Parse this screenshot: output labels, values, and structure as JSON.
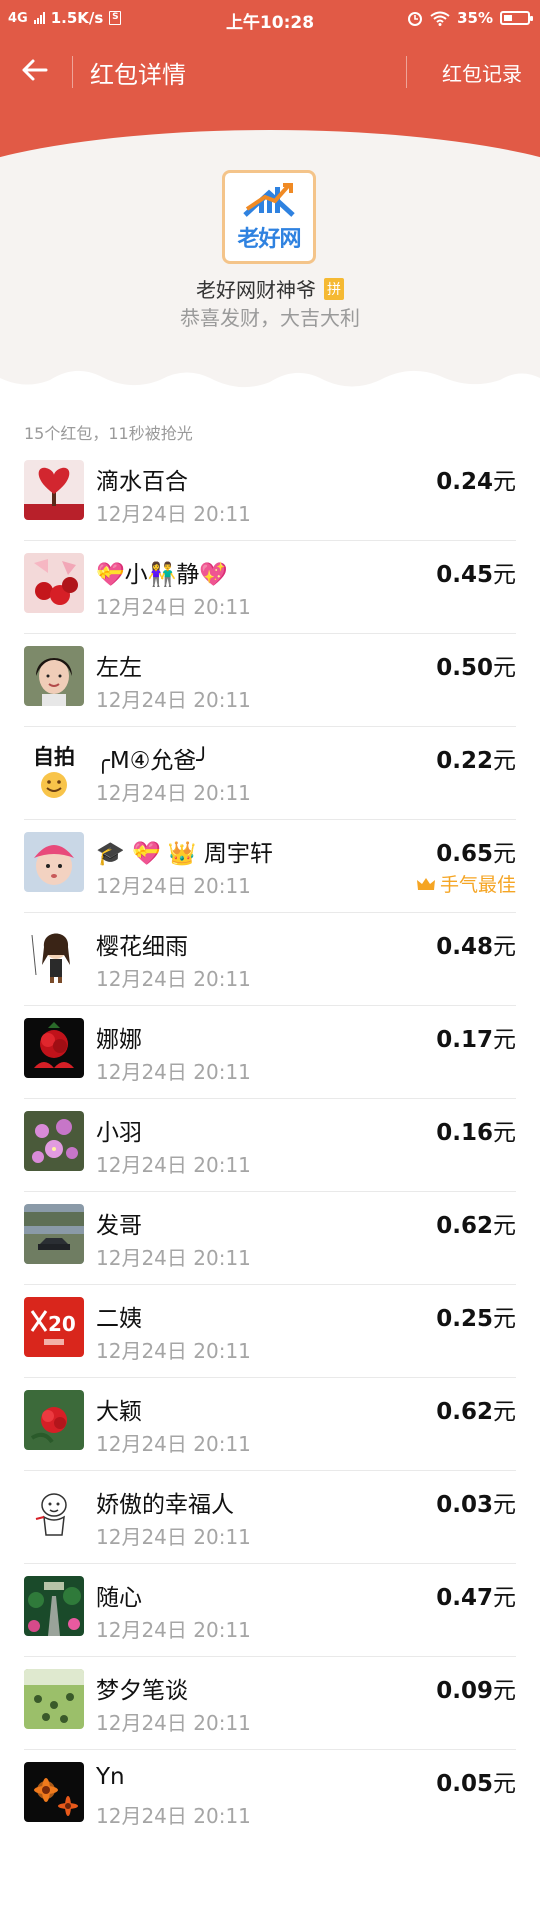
{
  "status_bar": {
    "network": "4G",
    "speed": "1.5K/s",
    "time": "上午10:28",
    "battery_percent": "35%",
    "battery_level": 0.35
  },
  "navbar": {
    "title": "红包详情",
    "record_link": "红包记录"
  },
  "sender": {
    "logo_text": "老好网",
    "name": "老好网财神爷",
    "badge": "拼",
    "greeting": "恭喜发财，大吉大利"
  },
  "summary": "15个红包，11秒被抢光",
  "colors": {
    "header": "#e15a46",
    "best_luck": "#f5a524"
  },
  "entries": [
    {
      "name": "滴水百合",
      "time": "12月24日  20:11",
      "amount": "0.24",
      "unit": "元",
      "avatar": "red-heart-tree"
    },
    {
      "name": "💝小👫静💖",
      "time": "12月24日  20:11",
      "amount": "0.45",
      "unit": "元",
      "avatar": "roses"
    },
    {
      "name": "左左",
      "time": "12月24日  20:11",
      "amount": "0.50",
      "unit": "元",
      "avatar": "woman-portrait"
    },
    {
      "name": "╭M④允爸╯",
      "time": "12月24日  20:11",
      "amount": "0.22",
      "unit": "元",
      "avatar": "selfie-smiley",
      "avatar_text": "自拍"
    },
    {
      "name": "🎓 💝 👑 周宇轩",
      "time": "12月24日  20:11",
      "amount": "0.65",
      "unit": "元",
      "avatar": "baby",
      "best_label": "手气最佳"
    },
    {
      "name": "樱花细雨",
      "time": "12月24日  20:11",
      "amount": "0.48",
      "unit": "元",
      "avatar": "cartoon-girl"
    },
    {
      "name": "娜娜",
      "time": "12月24日  20:11",
      "amount": "0.17",
      "unit": "元",
      "avatar": "red-flower-dark"
    },
    {
      "name": "小羽",
      "time": "12月24日  20:11",
      "amount": "0.16",
      "unit": "元",
      "avatar": "pink-flowers"
    },
    {
      "name": "发哥",
      "time": "12月24日  20:11",
      "amount": "0.62",
      "unit": "元",
      "avatar": "landscape-car"
    },
    {
      "name": "二姨",
      "time": "12月24日  20:11",
      "amount": "0.25",
      "unit": "元",
      "avatar": "x20-red"
    },
    {
      "name": "大颖",
      "time": "12月24日  20:11",
      "amount": "0.62",
      "unit": "元",
      "avatar": "red-flower-green"
    },
    {
      "name": "娇傲的幸福人",
      "time": "12月24日  20:11",
      "amount": "0.03",
      "unit": "元",
      "avatar": "cartoon-sketch"
    },
    {
      "name": "随心",
      "time": "12月24日  20:11",
      "amount": "0.47",
      "unit": "元",
      "avatar": "garden-path"
    },
    {
      "name": "梦夕笔谈",
      "time": "12月24日  20:11",
      "amount": "0.09",
      "unit": "元",
      "avatar": "green-field"
    },
    {
      "name": "Yn",
      "time": "12月24日  20:11",
      "amount": "0.05",
      "unit": "元",
      "avatar": "orange-daisies"
    }
  ]
}
